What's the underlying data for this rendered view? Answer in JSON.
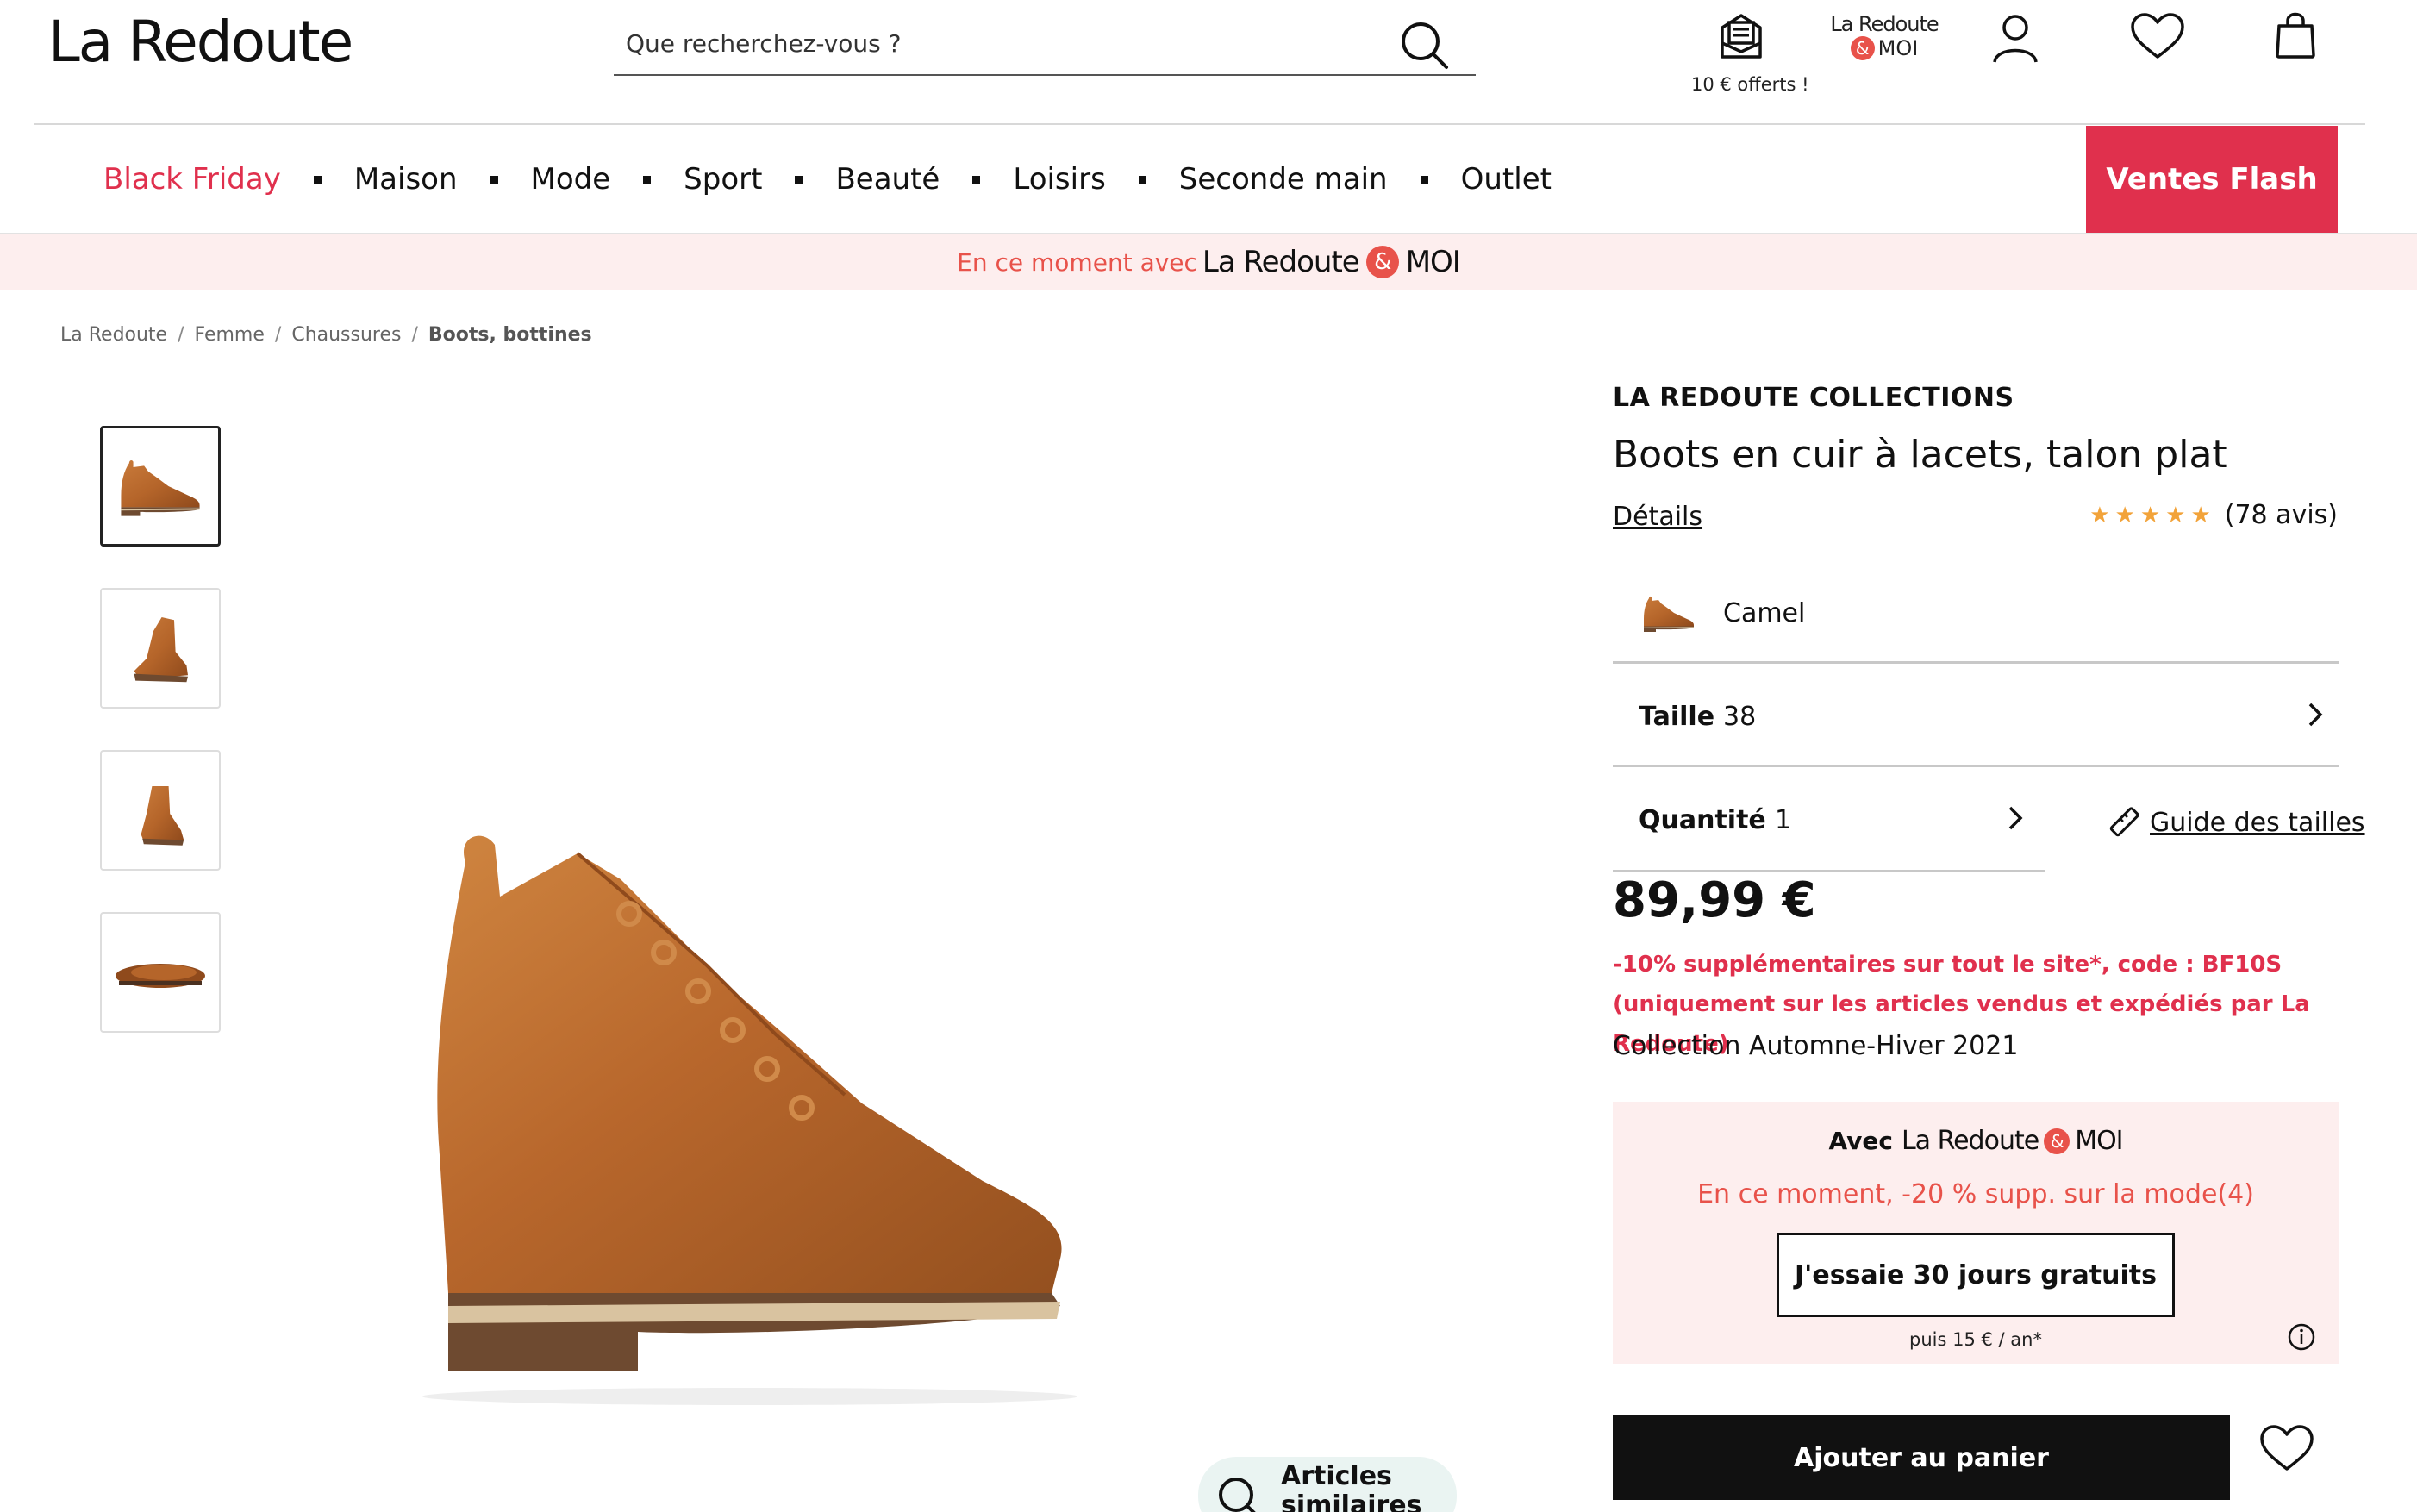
{
  "header": {
    "logo": "La Redoute",
    "search_placeholder": "Que recherchez-vous ?",
    "offer_label": "10 € offerts !",
    "moi_logo_line1": "La Redoute",
    "moi_logo_amp": "&",
    "moi_logo_line2": "MOI"
  },
  "nav": {
    "items": [
      "Black Friday",
      "Maison",
      "Mode",
      "Sport",
      "Beauté",
      "Loisirs",
      "Seconde main",
      "Outlet"
    ],
    "ventes_flash": "Ventes Flash"
  },
  "promo_band": {
    "text": "En ce moment avec",
    "brand": "La Redoute",
    "amp": "&",
    "moi": "MOI"
  },
  "breadcrumb": [
    "La Redoute",
    "Femme",
    "Chaussures",
    "Boots, bottines"
  ],
  "product": {
    "brand": "LA REDOUTE COLLECTIONS",
    "title": "Boots en cuir à lacets, talon plat",
    "details_link": "Détails",
    "rating_stars": "★★★★★",
    "rating_count": "(78 avis)",
    "color": "Camel",
    "size_label": "Taille",
    "size_value": "38",
    "qty_label": "Quantité",
    "qty_value": "1",
    "size_guide": "Guide des tailles",
    "price": "89,99 €",
    "promo_code": "-10% supplémentaires sur tout le site*, code : BF10S (uniquement sur les articles vendus et expédiés par La Redoute)",
    "collection": "Collection Automne-Hiver 2021",
    "add_to_cart": "Ajouter au panier",
    "similar_label": "Articles similaires"
  },
  "moi_box": {
    "avec": "Avec",
    "brand": "La Redoute",
    "amp": "&",
    "moi": "MOI",
    "offer": "En ce moment, -20 % supp. sur la mode(4)",
    "trial_button": "J'essaie 30 jours gratuits",
    "after": "puis 15 € / an*"
  },
  "colors": {
    "accent": "#e0304d",
    "moi_orange": "#e8524a",
    "leather": "#b8672c"
  }
}
